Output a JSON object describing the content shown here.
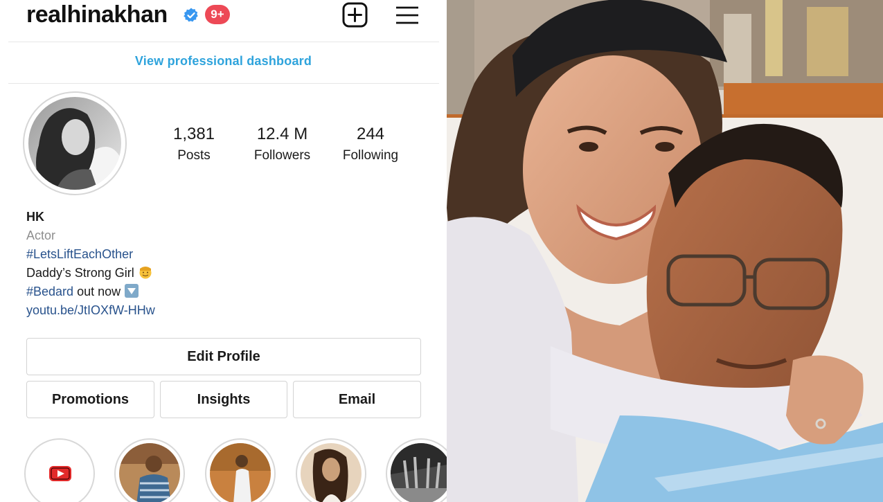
{
  "header": {
    "username": "realhinakhan",
    "notification_badge": "9+"
  },
  "dashboard": {
    "link_label": "View professional dashboard"
  },
  "stats": [
    {
      "value": "1,381",
      "label": "Posts"
    },
    {
      "value": "12.4 M",
      "label": "Followers"
    },
    {
      "value": "244",
      "label": "Following"
    }
  ],
  "bio": {
    "name": "HK",
    "category": "Actor",
    "hashtag_line": "#LetsLiftEachOther",
    "line2": "Daddy’s Strong Girl",
    "bedard_tag": "#Bedard",
    "bedard_rest": " out now",
    "link": "youtu.be/JtIOXfW-HHw"
  },
  "buttons": {
    "edit_profile": "Edit Profile",
    "promotions": "Promotions",
    "insights": "Insights",
    "email": "Email"
  },
  "colors": {
    "accent_link": "#2ea3dc",
    "hashtag": "#28528c",
    "badge": "#ed4956",
    "verified": "#3897f0"
  },
  "icons": [
    "verified-badge-icon",
    "new-post-plus-icon",
    "hamburger-menu-icon",
    "youtube-icon",
    "sunglasses-emoji-icon",
    "down-arrow-emoji-icon"
  ]
}
